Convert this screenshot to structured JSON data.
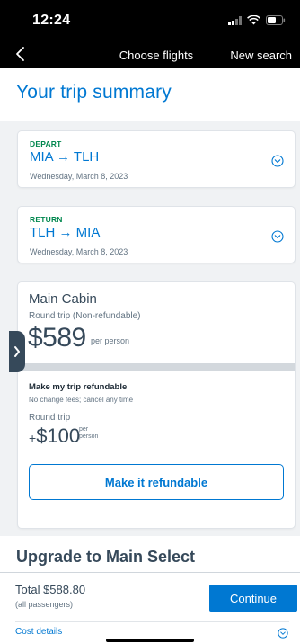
{
  "status_bar": {
    "time": "12:24"
  },
  "nav": {
    "title": "Choose flights",
    "action": "New search"
  },
  "summary": {
    "title": "Your trip summary"
  },
  "legs": [
    {
      "type": "DEPART",
      "route": "MIA → TLH",
      "date": "Wednesday, March 8, 2023"
    },
    {
      "type": "RETURN",
      "route": "TLH → MIA",
      "date": "Wednesday, March 8, 2023"
    }
  ],
  "fare": {
    "cabin": "Main Cabin",
    "type": "Round trip (Non-refundable)",
    "price": "$589",
    "unit": "per person"
  },
  "refund": {
    "title": "Make my trip refundable",
    "subtitle": "No change fees; cancel any time",
    "trip_label": "Round trip",
    "price_plus": "+",
    "price": "$100",
    "unit": "per person",
    "button": "Make it refundable"
  },
  "upgrade": {
    "title": "Upgrade to Main Select"
  },
  "bottom": {
    "total": "Total $588.80",
    "total_sub": "(all passengers)",
    "continue": "Continue",
    "cost_details": "Cost details"
  },
  "colors": {
    "accent": "#0078d2",
    "depart_green": "#00874e",
    "text_dark": "#36495a"
  },
  "icons": {
    "back": "chevron-left-icon",
    "expand": "chevron-down-circle-icon",
    "drawer": "chevron-right-icon"
  }
}
